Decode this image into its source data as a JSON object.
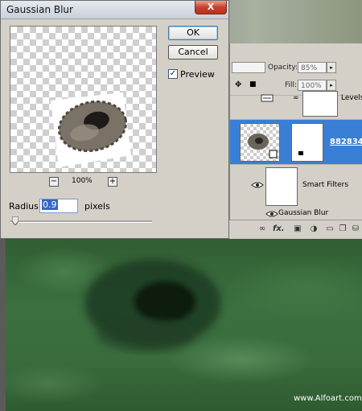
{
  "dialog": {
    "title": "Gaussian Blur",
    "ok_label": "OK",
    "cancel_label": "Cancel",
    "close_label": "X",
    "preview_label": "Preview",
    "preview_checked": true,
    "zoom_minus": "−",
    "zoom_plus": "+",
    "zoom_level": "100%",
    "radius_label": "Radius:",
    "radius_value": "0.9",
    "radius_unit": "pixels",
    "radius_slider_fraction": 0.01
  },
  "layers_panel": {
    "opacity_label": "Opacity:",
    "opacity_value": "85%",
    "fill_label": "Fill:",
    "fill_value": "100%",
    "layers": [
      {
        "name": "Levels"
      },
      {
        "name": "882834...",
        "selected": true
      },
      {
        "name": "Smart Filters"
      },
      {
        "name": "Gaussian Blur"
      }
    ],
    "bottom_icons": [
      "link-icon",
      "fx-icon",
      "mask-icon",
      "adjustment-icon",
      "group-icon",
      "new-layer-icon",
      "trash-icon"
    ],
    "fx_label": "fx."
  },
  "canvas": {
    "watermark": "www.Alfoart.com"
  },
  "colors": {
    "selection_blue": "#3a7fd6",
    "dialog_gray": "#d4d0c8",
    "close_red": "#c8402c"
  }
}
